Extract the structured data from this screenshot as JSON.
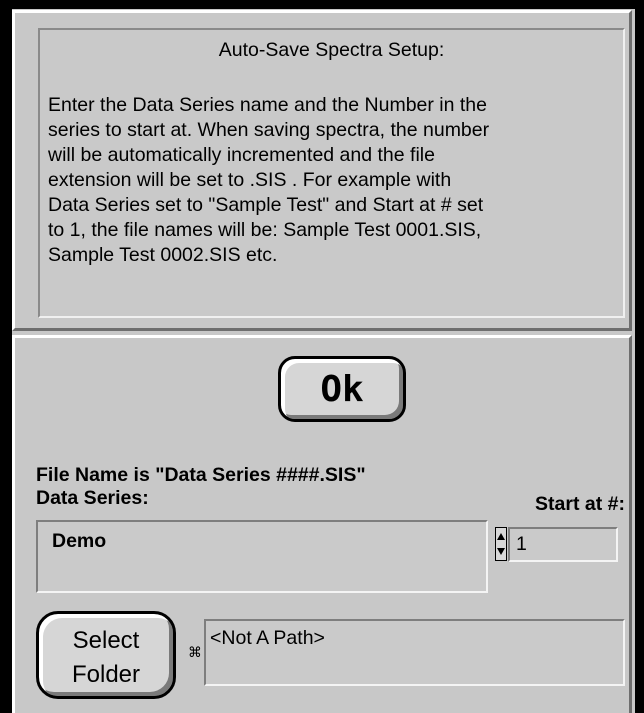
{
  "info": {
    "title": "Auto-Save Spectra Setup:",
    "body": "Enter the Data Series name and the Number in the\nseries to start at.  When saving spectra, the number\nwill be automatically incremented and the file\nextension will be set to .SIS .  For example with\nData Series set to \"Sample Test\" and Start at # set\nto 1, the file names will be:  Sample Test 0001.SIS,\nSample Test 0002.SIS etc."
  },
  "ok_button": {
    "label": "Ok"
  },
  "file_name_label": "File Name is \"Data Series ####.SIS\"",
  "data_series": {
    "label": "Data Series:",
    "value": "Demo"
  },
  "start_at": {
    "label": "Start at #:",
    "value": "1"
  },
  "select_folder_button": {
    "label": "Select\nFolder"
  },
  "folder_path": {
    "value": "<Not A Path>",
    "browse_icon": "folder-browse-icon"
  },
  "colors": {
    "panel": "#c8c8c8",
    "border": "#000000"
  }
}
